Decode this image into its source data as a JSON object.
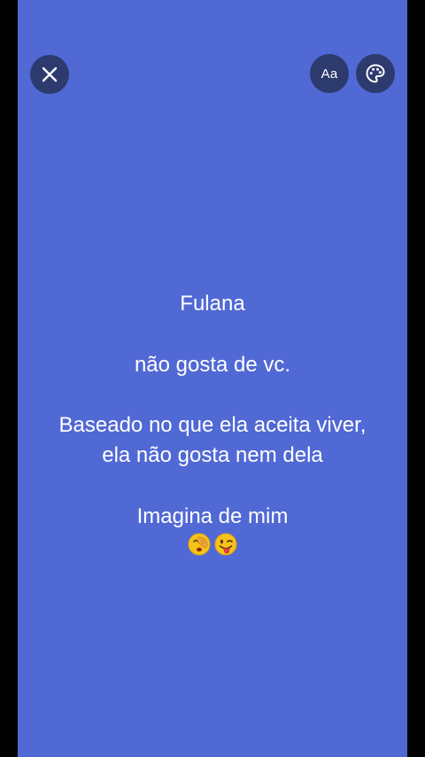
{
  "buttons": {
    "close_icon": "close-icon",
    "font_label": "Aa",
    "palette_icon": "palette-icon"
  },
  "post": {
    "line1": "Fulana",
    "line2": "não gosta de vc.",
    "line3": "Baseado no que ela aceita viver,",
    "line4": "ela não gosta nem dela",
    "line5": "Imagina de mim",
    "emojis": [
      "face-with-hand-over-eyes-emoji",
      "winking-face-with-tongue-emoji"
    ]
  },
  "colors": {
    "background": "#5169d4",
    "button_bg": "#2c3a6d",
    "text": "#ffffff"
  }
}
